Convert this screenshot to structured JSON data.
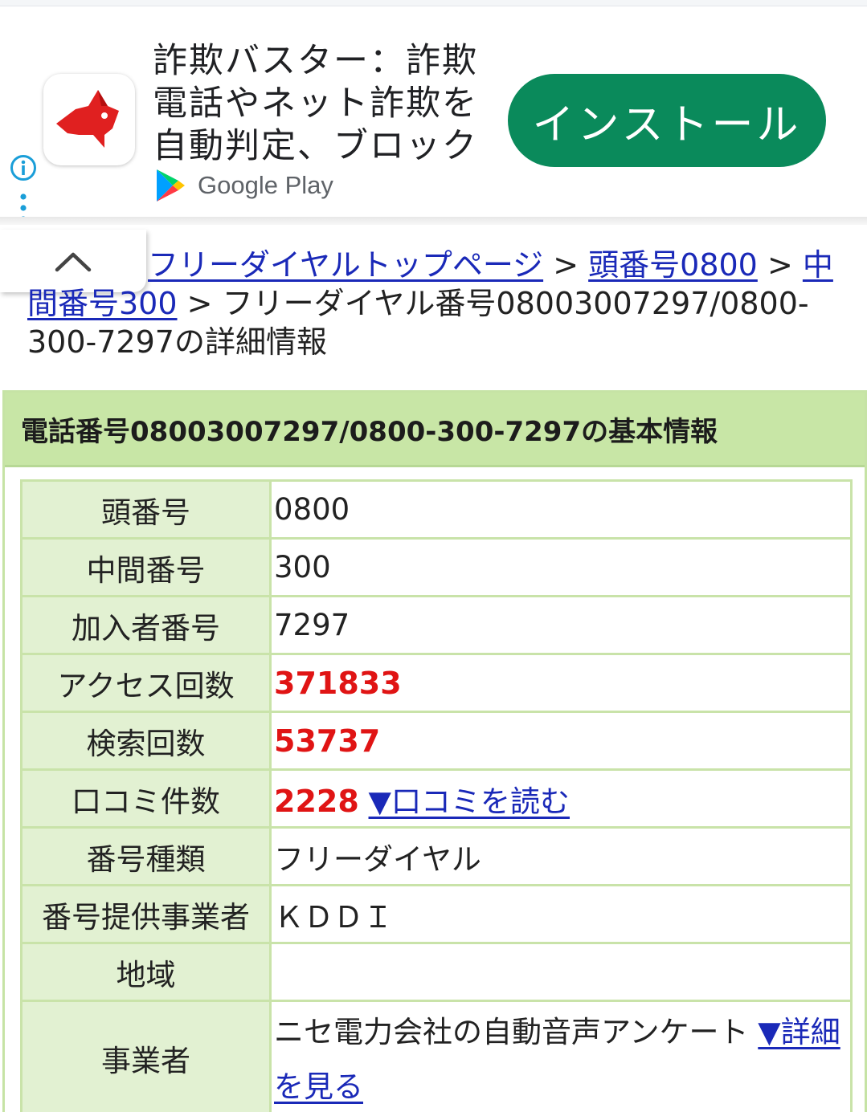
{
  "ad": {
    "title": "詐欺バスター：詐欺電話やネット詐欺を自動判定、ブロック",
    "store": "Google Play",
    "install": "インストール",
    "colors": {
      "install_bg": "#0a8a5b",
      "icon_red": "#e02020"
    }
  },
  "breadcrumb": {
    "top": "フリーダイヤルトップページ",
    "sep": ">",
    "prefix_line1": "頭番号0800",
    "middle_a": "中",
    "middle_b": "間番号300",
    "current": "フリーダイヤル番号08003007297/0800-300-7297の詳細情報"
  },
  "basic_info": {
    "heading": "電話番号08003007297/0800-300-7297の基本情報",
    "rows": [
      {
        "label": "頭番号",
        "value": "0800"
      },
      {
        "label": "中間番号",
        "value": "300"
      },
      {
        "label": "加入者番号",
        "value": "7297"
      },
      {
        "label": "アクセス回数",
        "value": "371833"
      },
      {
        "label": "検索回数",
        "value": "53737"
      },
      {
        "label": "口コミ件数",
        "value": "2228",
        "link": "▼口コミを読む"
      },
      {
        "label": "番号種類",
        "value": "フリーダイヤル"
      },
      {
        "label": "番号提供事業者",
        "value": "ＫＤＤＩ"
      },
      {
        "label": "地域",
        "value": ""
      },
      {
        "label": "事業者",
        "value": "ニセ電力会社の自動音声アンケート",
        "link": "▼詳細を見る"
      }
    ]
  },
  "colors": {
    "header_bg": "#c8e6a6",
    "label_bg": "#e2f1d2",
    "highlight": "#e01414",
    "link": "#1a29b8"
  }
}
